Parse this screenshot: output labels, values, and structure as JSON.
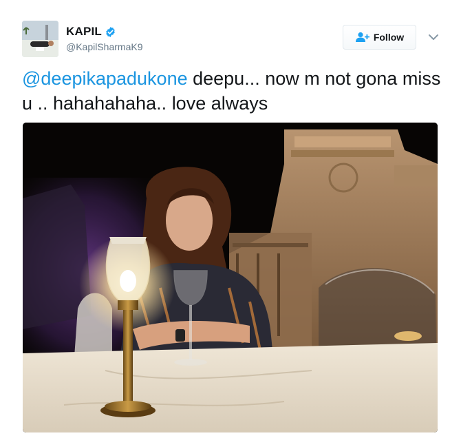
{
  "user": {
    "display_name": "KAPIL",
    "handle": "@KapilSharmaK9",
    "verified": true
  },
  "follow_button": {
    "label": "Follow",
    "icon": "add-user-icon"
  },
  "menu": {
    "icon": "chevron-down-icon"
  },
  "tweet": {
    "mention": "@deepikapadukone",
    "text": " deepu... now m not gona miss u .. hahahahaha.. love always"
  },
  "media": {
    "type": "photo",
    "icon": "photo"
  },
  "colors": {
    "link": "#1b95e0",
    "verified": "#1da1f2",
    "text": "#14171a",
    "muted": "#657786"
  }
}
